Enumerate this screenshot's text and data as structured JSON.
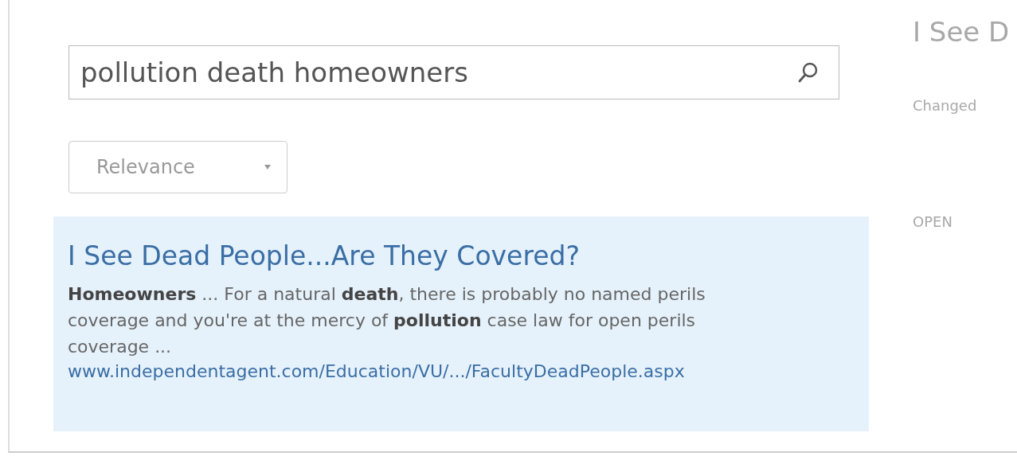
{
  "search": {
    "value": "pollution death homeowners"
  },
  "sort": {
    "value": "Relevance"
  },
  "results": [
    {
      "title": "I See Dead People...Are They Covered?",
      "snippet": "**Homeowners** ... For a natural **death**, there is probably no named perils coverage and you're at the mercy of **pollution** case law for open perils coverage ...",
      "url": "www.independentagent.com/Education/VU/.../FacultyDeadPeople.aspx",
      "selected": true
    }
  ],
  "preview": {
    "title": "I See D",
    "label": "Changed",
    "button": "OPEN"
  }
}
